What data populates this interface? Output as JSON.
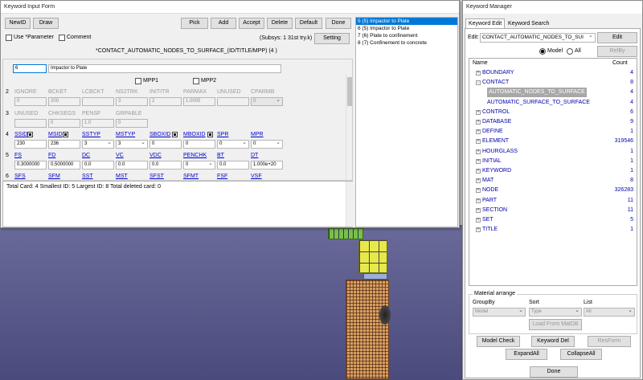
{
  "kif": {
    "title": "Keyword Input Form",
    "buttons": {
      "newid": "NewID",
      "draw": "Draw",
      "pick": "Pick",
      "add": "Add",
      "accept": "Accept",
      "delete": "Delete",
      "default": "Default",
      "done": "Done",
      "setting": "Setting"
    },
    "use_param": "Use *Parameter",
    "comment": "Comment",
    "subsys": "(Subsys: 1 31st try.k)",
    "keyword_line": "*CONTACT_AUTOMATIC_NODES_TO_SURFACE_(ID/TITLE/MPP)    (4 )",
    "row1": {
      "cid": "6",
      "title": "Impactor to Plate"
    },
    "mpp1": "MPP1",
    "mpp2": "MPP2",
    "r2": {
      "num": "2",
      "labels": [
        "IGNORE",
        "BCKET",
        "LCBCKT",
        "NS2TRK",
        "INITITR",
        "PARMAX",
        "UNUSED",
        "CPARMB"
      ],
      "values": [
        "0",
        "200",
        "",
        "3",
        "2",
        "1.0005",
        "",
        "0"
      ]
    },
    "r3": {
      "num": "3",
      "labels": [
        "UNUSED",
        "CHKSEGS",
        "PENSF",
        "GRPABLE"
      ],
      "values": [
        "",
        "0",
        "1.0",
        "0"
      ]
    },
    "r4": {
      "num": "4",
      "labels": [
        "SSID",
        "MSID",
        "SSTYP",
        "MSTYP",
        "SBOXID",
        "MBOXID",
        "SPR",
        "MPR"
      ],
      "values": [
        "230",
        "236",
        "3",
        "3",
        "0",
        "0",
        "0",
        "0"
      ]
    },
    "r5": {
      "num": "5",
      "labels": [
        "FS",
        "FD",
        "DC",
        "VC",
        "VDC",
        "PENCHK",
        "BT",
        "DT"
      ],
      "values": [
        "0.3000000",
        "0.5000000",
        "0.0",
        "0.0",
        "0.0",
        "0",
        "0.0",
        "1.000e+20"
      ]
    },
    "r6": {
      "num": "6",
      "labels": [
        "SFS",
        "SFM",
        "SST",
        "MST",
        "SFST",
        "SFMT",
        "FSF",
        "VSF"
      ]
    },
    "status": "Total Card: 4   Smallest ID: 5   Largest ID: 8   Total deleted card:  0",
    "list": [
      "5   (5) Impactor to Plate",
      "6   (5) Impactor to Plate",
      "7   (6) Plate to confinement",
      "8   (7) Confinement to concrete"
    ]
  },
  "km": {
    "title": "Keyword Manager",
    "tabs": [
      "Keyword Edit",
      "Keyword Search"
    ],
    "edit_label": "Edit:",
    "edit_value": "CONTACT_AUTOMATIC_NODES_TO_SUI",
    "edit_btn": "Edit",
    "radio_model": "Model",
    "radio_all": "All",
    "refby": "RefBy",
    "col_name": "Name",
    "col_count": "Count",
    "tree": [
      {
        "pm": "+",
        "name": "BOUNDARY",
        "count": "4",
        "indent": 0
      },
      {
        "pm": "-",
        "name": "CONTACT",
        "count": "8",
        "indent": 0
      },
      {
        "pm": "",
        "name": "AUTOMATIC_NODES_TO_SURFACE",
        "count": "4",
        "indent": 1,
        "selected": true
      },
      {
        "pm": "",
        "name": "AUTOMATIC_SURFACE_TO_SURFACE",
        "count": "4",
        "indent": 1
      },
      {
        "pm": "+",
        "name": "CONTROL",
        "count": "6",
        "indent": 0
      },
      {
        "pm": "+",
        "name": "DATABASE",
        "count": "9",
        "indent": 0
      },
      {
        "pm": "+",
        "name": "DEFINE",
        "count": "1",
        "indent": 0
      },
      {
        "pm": "+",
        "name": "ELEMENT",
        "count": "319546",
        "indent": 0
      },
      {
        "pm": "+",
        "name": "HOURGLASS",
        "count": "1",
        "indent": 0
      },
      {
        "pm": "+",
        "name": "INITIAL",
        "count": "1",
        "indent": 0
      },
      {
        "pm": "+",
        "name": "KEYWORD",
        "count": "1",
        "indent": 0
      },
      {
        "pm": "+",
        "name": "MAT",
        "count": "8",
        "indent": 0
      },
      {
        "pm": "+",
        "name": "NODE",
        "count": "326283",
        "indent": 0
      },
      {
        "pm": "+",
        "name": "PART",
        "count": "11",
        "indent": 0
      },
      {
        "pm": "+",
        "name": "SECTION",
        "count": "11",
        "indent": 0
      },
      {
        "pm": "+",
        "name": "SET",
        "count": "5",
        "indent": 0
      },
      {
        "pm": "+",
        "name": "TITLE",
        "count": "1",
        "indent": 0
      }
    ],
    "material_arrange": "Material arrange",
    "groupby": "GroupBy",
    "sort": "Sort",
    "list": "List",
    "groupby_val": "Model",
    "sort_val": "Type",
    "list_val": "All",
    "load_matdb": "Load From MatDB",
    "model_check": "Model Check",
    "keyword_del": "Keyword Del",
    "reform": "ResForm",
    "expand_all": "ExpandAll",
    "collapse_all": "CollapseAll",
    "done": "Done"
  },
  "colors": {
    "selected_bg": "#a8a8a8",
    "link": "#0000cc",
    "list_select": "#0078d7"
  }
}
